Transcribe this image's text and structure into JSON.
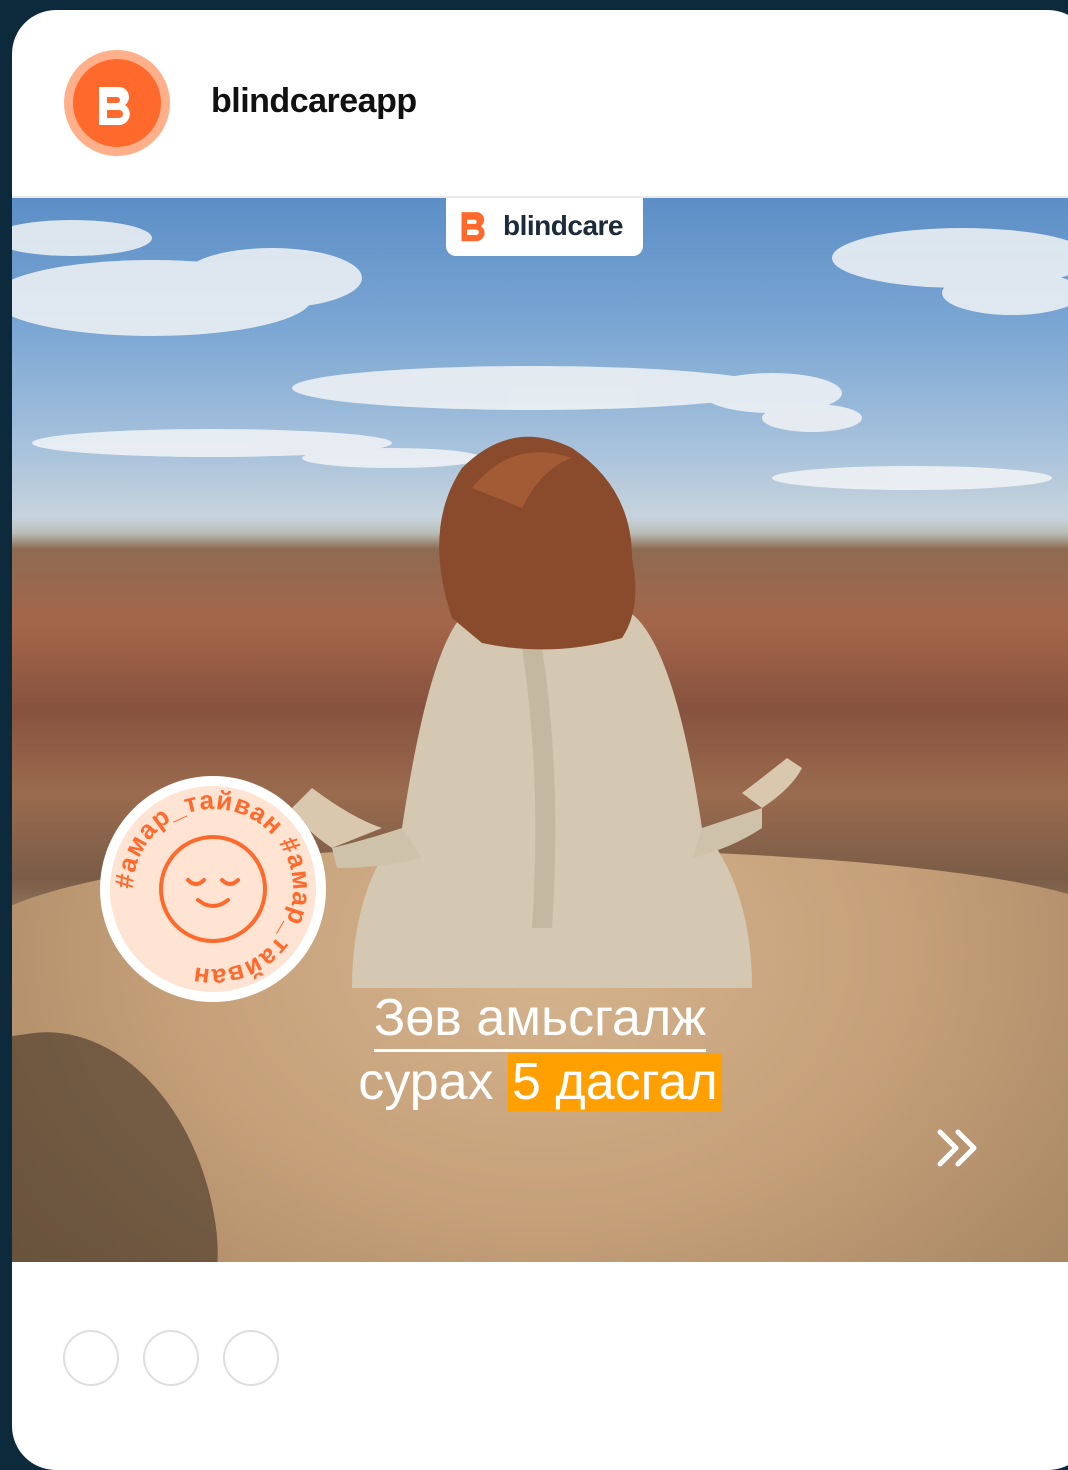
{
  "post": {
    "username": "blindcareapp",
    "brand_badge": "blindcare",
    "sticker_text": "#амар_тайван #амар_тайван",
    "headline_line1": "Зөв амьсгалж",
    "headline_line2_plain": "сурах",
    "headline_line2_highlight": "5 дасгал"
  },
  "icons": {
    "avatar": "blindcare-logo-icon",
    "badge": "blindcare-logo-icon",
    "sticker": "smiley-face-icon",
    "next": "double-chevron-right-icon"
  },
  "actions": [
    {
      "name": "action-circle-1"
    },
    {
      "name": "action-circle-2"
    },
    {
      "name": "action-circle-3"
    }
  ],
  "colors": {
    "background": "#0c2a3c",
    "brand_orange": "#ff6a2c",
    "avatar_ring": "#ffb08a",
    "highlight": "#ff9f00",
    "sticker_peach": "#ffe3d3"
  }
}
